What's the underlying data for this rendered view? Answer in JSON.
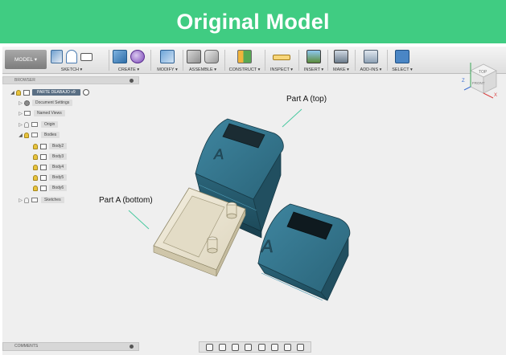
{
  "banner": {
    "title": "Original Model"
  },
  "toolbar": {
    "mode_label": "MODEL ▾",
    "groups": [
      {
        "label": "SKETCH ▾"
      },
      {
        "label": "CREATE ▾"
      },
      {
        "label": "MODIFY ▾"
      },
      {
        "label": "ASSEMBLE ▾"
      },
      {
        "label": "CONSTRUCT ▾"
      },
      {
        "label": "INSPECT ▾"
      },
      {
        "label": "INSERT ▾"
      },
      {
        "label": "MAKE ▾"
      },
      {
        "label": "ADD-INS ▾"
      },
      {
        "label": "SELECT ▾"
      }
    ]
  },
  "viewcube": {
    "top": "TOP",
    "front": "FRONT",
    "x": "X",
    "z": "Z"
  },
  "browser": {
    "title": "BROWSER",
    "root_label": "PARTE DEABAJO v9",
    "items": [
      {
        "label": "Document Settings",
        "icon": "gear-icon"
      },
      {
        "label": "Named Views",
        "icon": "folder-icon"
      },
      {
        "label": "Origin",
        "icon": "folder-icon"
      },
      {
        "label": "Bodies",
        "icon": "folder-icon"
      },
      {
        "label": "Body2",
        "icon": "body-icon"
      },
      {
        "label": "Body3",
        "icon": "body-icon"
      },
      {
        "label": "Body4",
        "icon": "body-icon"
      },
      {
        "label": "Body5",
        "icon": "body-icon"
      },
      {
        "label": "Body6",
        "icon": "body-icon"
      },
      {
        "label": "Sketches",
        "icon": "folder-icon"
      }
    ]
  },
  "annotations": {
    "top": "Part A (top)",
    "bottom": "Part A (bottom)"
  },
  "model": {
    "engraving": "A"
  },
  "comments": {
    "title": "COMMENTS"
  },
  "colors": {
    "banner": "#40cc82",
    "part_teal": "#2f6e84",
    "part_beige": "#ece6d3"
  }
}
